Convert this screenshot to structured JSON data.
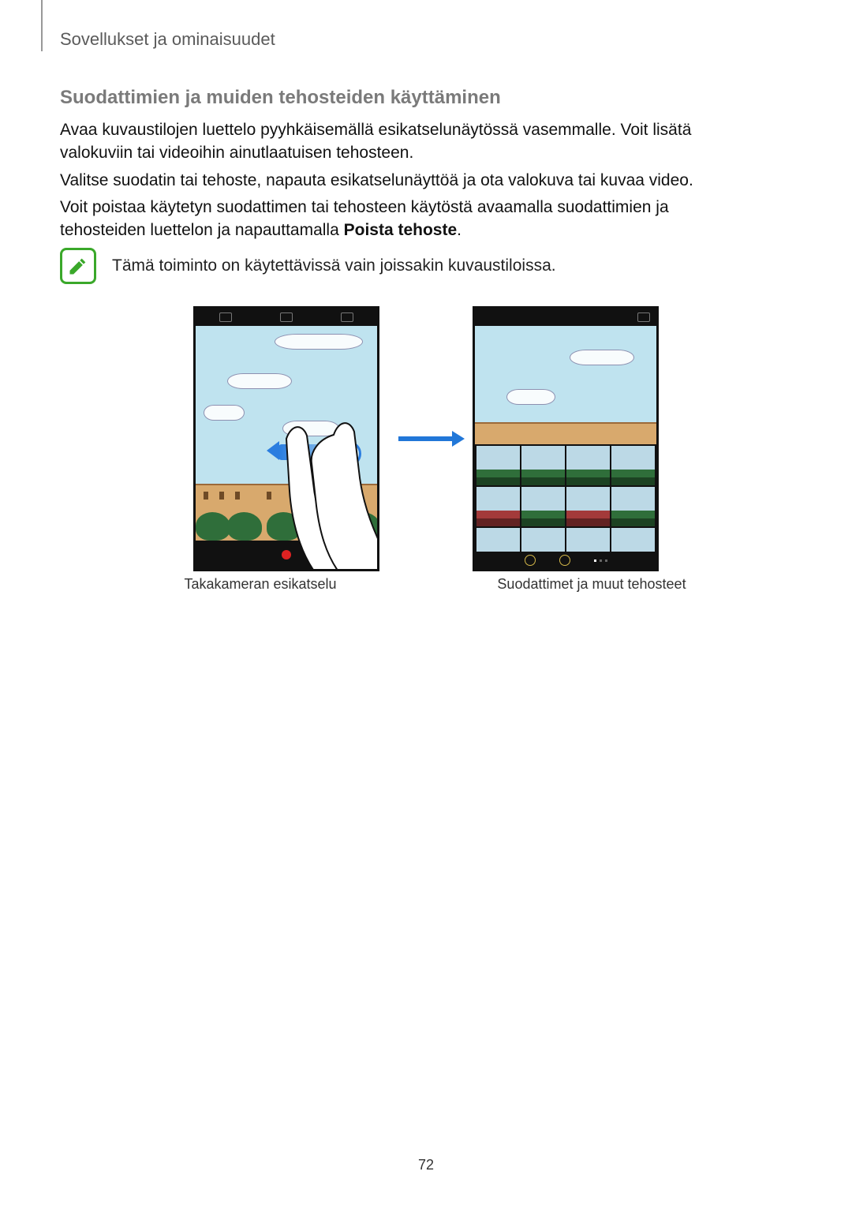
{
  "header": "Sovellukset ja ominaisuudet",
  "section_heading": "Suodattimien ja muiden tehosteiden käyttäminen",
  "paragraphs": {
    "p1": "Avaa kuvaustilojen luettelo pyyhkäisemällä esikatselunäytössä vasemmalle. Voit lisätä valokuviin tai videoihin ainutlaatuisen tehosteen.",
    "p2": "Valitse suodatin tai tehoste, napauta esikatselunäyttöä ja ota valokuva tai kuvaa video.",
    "p3_pre": "Voit poistaa käytetyn suodattimen tai tehosteen käytöstä avaamalla suodattimien ja tehosteiden luettelon ja napauttamalla ",
    "p3_bold": "Poista tehoste",
    "p3_post": "."
  },
  "note_text": "Tämä toiminto on käytettävissä vain joissakin kuvaustiloissa.",
  "captions": {
    "left": "Takakameran esikatselu",
    "right": "Suodattimet ja muut tehosteet"
  },
  "page_number": "72"
}
